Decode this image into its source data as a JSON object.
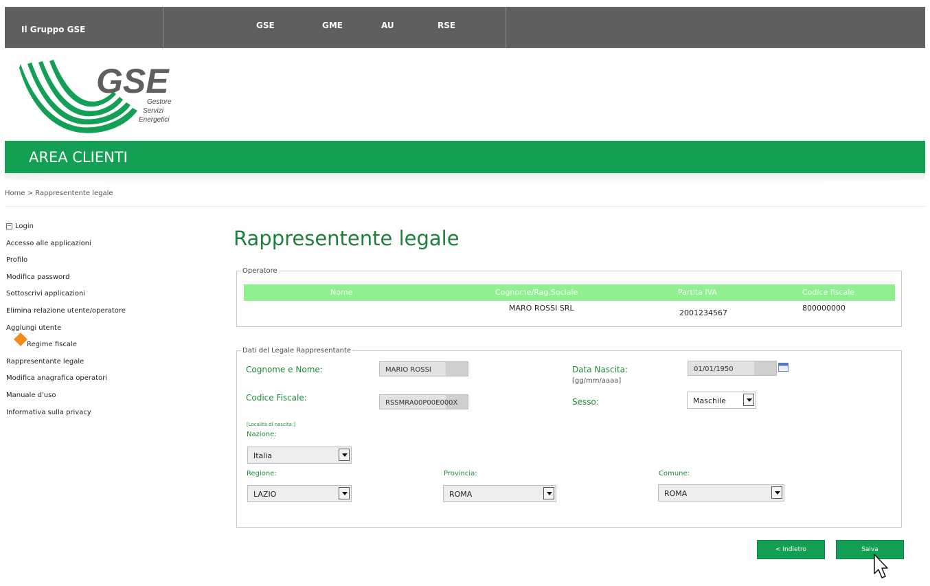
{
  "topbar": {
    "group_label": "Il Gruppo GSE",
    "links": [
      "GSE",
      "GME",
      "AU",
      "RSE"
    ]
  },
  "logo": {
    "brand": "GSE",
    "tagline_1": "Gestore",
    "tagline_2": "Servizi",
    "tagline_3": "Energetici"
  },
  "area_title": "AREA CLIENTI",
  "breadcrumb": "Home > Rappresentente legale",
  "sidebar": {
    "login": "Login",
    "items": [
      "Accesso alle applicazioni",
      "Profilo",
      "Modifica password",
      "Sottoscrivi applicazioni",
      "Elimina relazione utente/operatore",
      "Aggiungi utente"
    ],
    "highlighted": "Regime fiscale",
    "items_after": [
      "Rappresentante legale",
      "Modifica anagrafica operatori",
      "Manuale d'uso",
      "Informativa sulla privacy"
    ]
  },
  "page_title": "Rappresentente legale",
  "operatore": {
    "legend": "Operatore",
    "headers": {
      "nome": "Nome",
      "cognome": "Cognome/Rag.Sociale",
      "piva": "Partita IVA",
      "cf": "Codice fiscale"
    },
    "row": {
      "nome": "",
      "cognome": "MARO ROSSI SRL",
      "piva": "2001234567",
      "cf": "800000000"
    }
  },
  "legale": {
    "legend": "Dati del Legale Rappresentante",
    "cognome_label": "Cognome e Nome:",
    "cognome_value": "MARIO ROSSI",
    "nascita_label": "Data Nascita:",
    "nascita_hint": "[gg/mm/aaaa]",
    "nascita_value": "01/01/1950",
    "cf_label": "Codice Fiscale:",
    "cf_value": "RSSMRA00P00E000X",
    "sesso_label": "Sesso:",
    "sesso_value": "Maschile",
    "localita_label": "[Località di nascita:]",
    "nazione_label": "Nazione:",
    "nazione_value": "Italia",
    "regione_label": "Regione:",
    "regione_value": "LAZIO",
    "provincia_label": "Provincia:",
    "provincia_value": "ROMA",
    "comune_label": "Comune:",
    "comune_value": "ROMA"
  },
  "buttons": {
    "indietro": "< Indietro",
    "salva": "Salva"
  },
  "colors": {
    "brand_green": "#13a055",
    "header_gray": "#5f5f5f",
    "table_header": "#8ff08f",
    "label_green": "#1e8a3a"
  }
}
